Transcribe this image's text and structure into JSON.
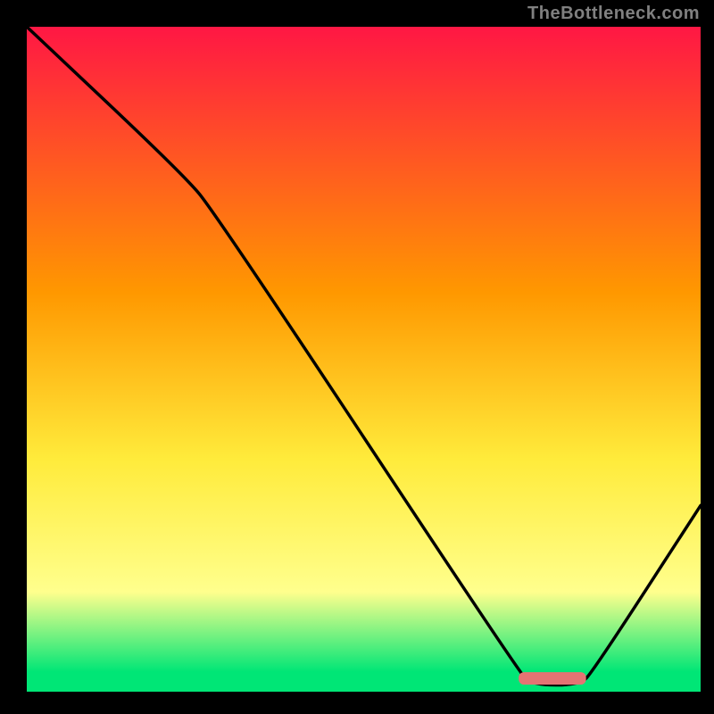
{
  "watermark": "TheBottleneck.com",
  "chart_data": {
    "type": "line",
    "title": "",
    "xlabel": "",
    "ylabel": "",
    "xlim": [
      0,
      100
    ],
    "ylim": [
      0,
      100
    ],
    "gradient": {
      "stops": [
        {
          "offset": 0,
          "color": "#ff1744"
        },
        {
          "offset": 40,
          "color": "#ff9800"
        },
        {
          "offset": 65,
          "color": "#ffeb3b"
        },
        {
          "offset": 85,
          "color": "#ffff8d"
        },
        {
          "offset": 97,
          "color": "#00e676"
        }
      ]
    },
    "series": [
      {
        "name": "bottleneck-curve",
        "points": [
          {
            "x": 0,
            "y": 100
          },
          {
            "x": 23,
            "y": 78
          },
          {
            "x": 28,
            "y": 72
          },
          {
            "x": 73,
            "y": 3
          },
          {
            "x": 75,
            "y": 1
          },
          {
            "x": 82,
            "y": 1
          },
          {
            "x": 84,
            "y": 3
          },
          {
            "x": 100,
            "y": 28
          }
        ]
      }
    ],
    "marker": {
      "shape": "rounded-bar",
      "x_start": 73,
      "x_end": 83,
      "y": 2,
      "color": "#e57373"
    }
  }
}
